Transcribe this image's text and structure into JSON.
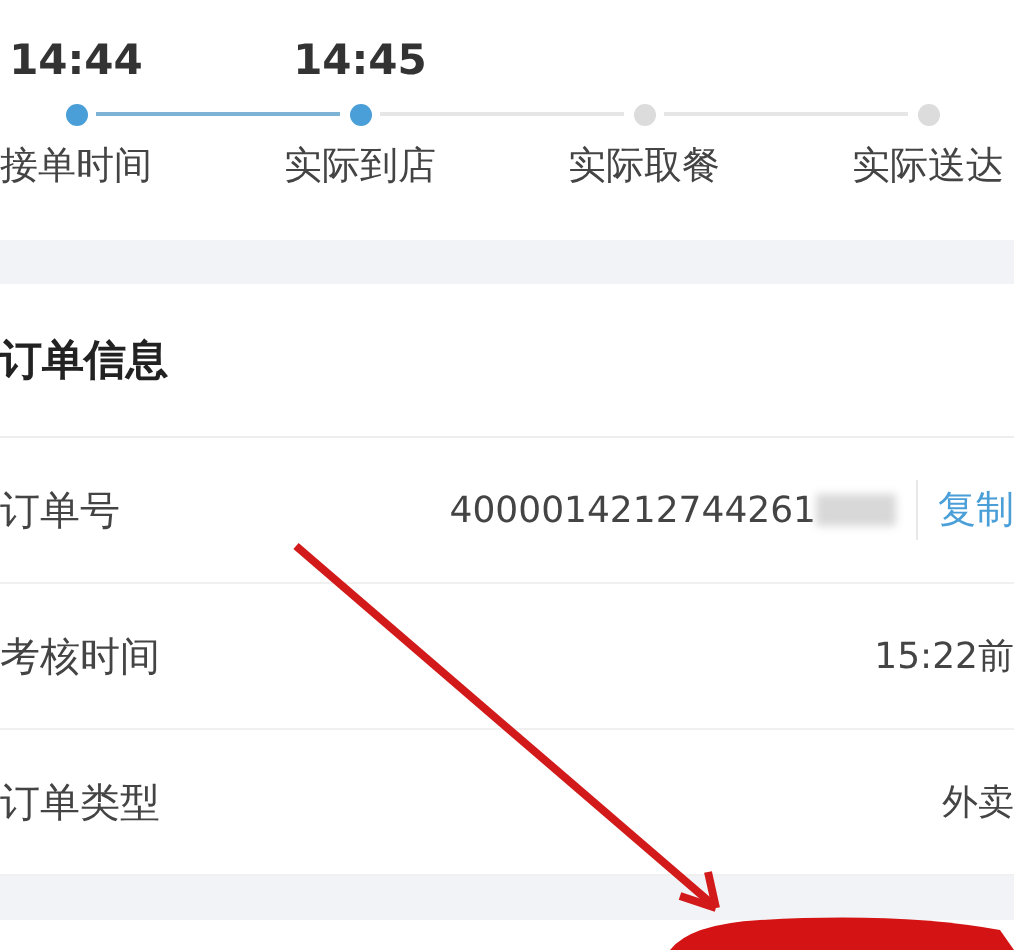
{
  "timeline": [
    {
      "time": "14:44",
      "label": "接单时间",
      "done": true
    },
    {
      "time": "14:45",
      "label": "实际到店",
      "done": true
    },
    {
      "label": "实际取餐",
      "done": false
    },
    {
      "label": "实际送达",
      "done": false
    }
  ],
  "order_info": {
    "title": "订单信息",
    "rows": [
      {
        "label": "订单号",
        "value": "4000014212744261",
        "blurred": true,
        "action": "复制"
      },
      {
        "label": "考核时间",
        "value": "15:22前"
      },
      {
        "label": "订单类型",
        "value": "外卖"
      }
    ]
  }
}
